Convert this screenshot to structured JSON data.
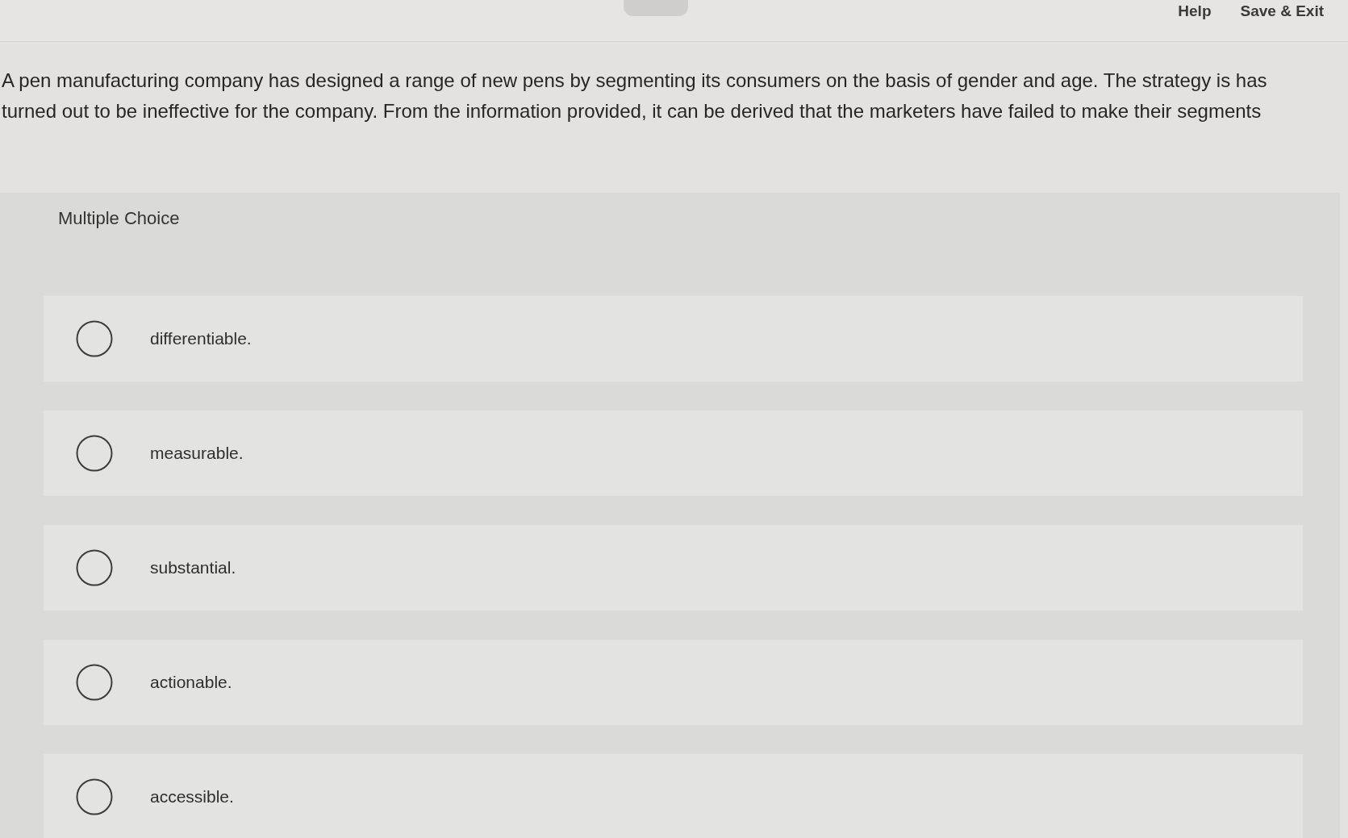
{
  "header": {
    "links": [
      "Help",
      "Save & Exit"
    ]
  },
  "question": {
    "text": "A pen manufacturing company has designed a range of new pens by segmenting its consumers on the basis of gender and age. The strategy is has turned out to be ineffective for the company. From the information provided, it can be derived that the marketers have failed to make their segments"
  },
  "answer": {
    "label": "Multiple Choice",
    "options": [
      {
        "text": "differentiable.",
        "selected": false
      },
      {
        "text": "measurable.",
        "selected": false
      },
      {
        "text": "substantial.",
        "selected": false
      },
      {
        "text": "actionable.",
        "selected": false
      },
      {
        "text": "accessible.",
        "selected": false
      }
    ]
  }
}
